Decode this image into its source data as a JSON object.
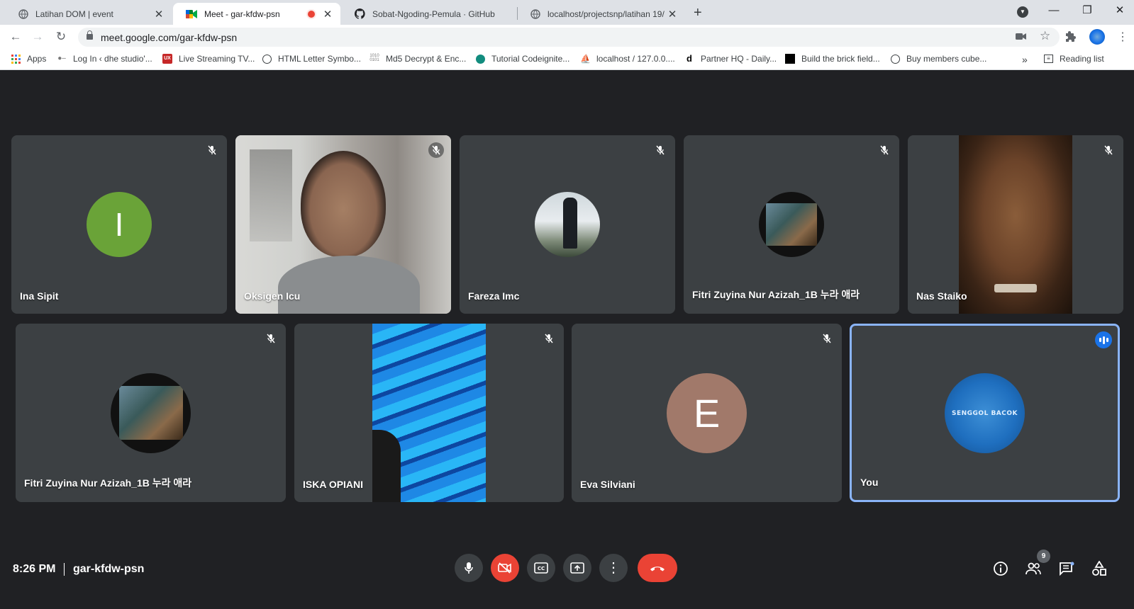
{
  "browser": {
    "tabs": [
      {
        "title": "Latihan DOM | event"
      },
      {
        "title": "Meet - gar-kfdw-psn"
      },
      {
        "title": "Sobat-Ngoding-Pemula · GitHub"
      },
      {
        "title": "localhost/projectsnp/latihan 19/"
      }
    ],
    "url": "meet.google.com/gar-kfdw-psn",
    "bookmarks": [
      {
        "label": "Apps"
      },
      {
        "label": "Log In ‹ dhe studio'..."
      },
      {
        "label": "Live Streaming TV..."
      },
      {
        "label": "HTML Letter Symbo..."
      },
      {
        "label": "Md5 Decrypt & Enc..."
      },
      {
        "label": "Tutorial Codeignite..."
      },
      {
        "label": "localhost / 127.0.0...."
      },
      {
        "label": "Partner HQ - Daily..."
      },
      {
        "label": "Build the brick field..."
      },
      {
        "label": "Buy members cube..."
      }
    ],
    "reading_list": "Reading list",
    "overflow": "»"
  },
  "meet": {
    "participants": [
      {
        "name": "Ina Sipit",
        "initial": "I",
        "avatar_color": "#6aa338"
      },
      {
        "name": "Oksigen Icu"
      },
      {
        "name": "Fareza Imc"
      },
      {
        "name": "Fitri Zuyina Nur Azizah_1B 누라 애라"
      },
      {
        "name": "Nas Staiko"
      },
      {
        "name": "Fitri Zuyina Nur Azizah_1B 누라 애라"
      },
      {
        "name": "ISKA OPIANI"
      },
      {
        "name": "Eva Silviani",
        "initial": "E",
        "avatar_color": "#a1796a"
      },
      {
        "name": "You",
        "avatar_text": "SENGGOL BACOK"
      }
    ],
    "time": "8:26 PM",
    "meeting_code": "gar-kfdw-psn",
    "people_count": "9"
  },
  "colors": {
    "background": "#202124",
    "tile": "#3c4043",
    "danger": "#ea4335",
    "speaking": "#8ab4f8",
    "accent": "#1a73e8"
  }
}
